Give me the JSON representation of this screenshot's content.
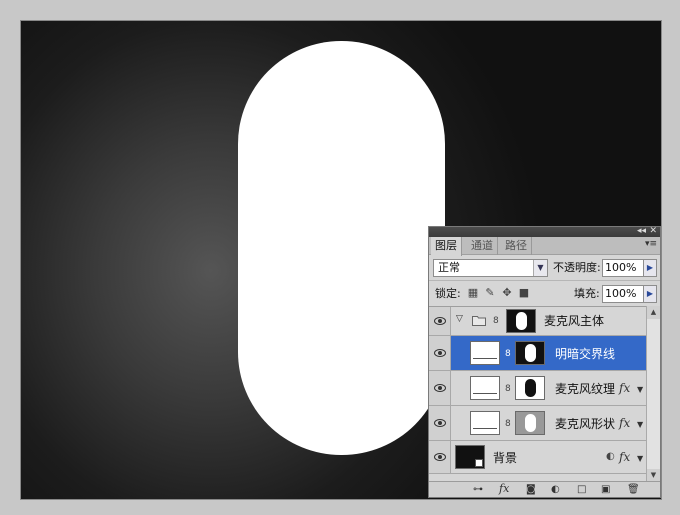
{
  "panel": {
    "tabs": [
      {
        "label": "图层"
      },
      {
        "label": "通道"
      },
      {
        "label": "路径"
      }
    ],
    "blend_mode": "正常",
    "opacity_label": "不透明度:",
    "opacity_value": "100%",
    "lock_label": "锁定:",
    "fill_label": "填充:",
    "fill_value": "100%"
  },
  "layers": [
    {
      "name": "麦克风主体",
      "type": "group",
      "selected": false
    },
    {
      "name": "明暗交界线",
      "type": "layer",
      "selected": true
    },
    {
      "name": "麦克风纹理",
      "type": "layer",
      "selected": false,
      "fx": "fx"
    },
    {
      "name": "麦克风形状",
      "type": "layer",
      "selected": false,
      "fx": "fx"
    },
    {
      "name": "背景",
      "type": "background",
      "selected": false,
      "fx": "fx"
    }
  ],
  "icons": {
    "eye": "eye-icon",
    "group": "folder-icon",
    "link": "chain-link-icon"
  },
  "colors": {
    "selection": "#3469c8",
    "capsule": "#ffffff",
    "canvas_dark": "#111111"
  }
}
